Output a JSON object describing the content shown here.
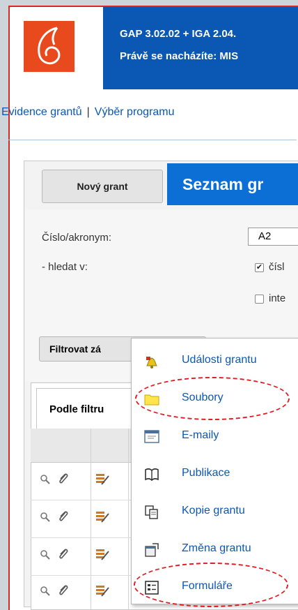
{
  "header": {
    "line1": "GAP 3.02.02 + IGA 2.04.",
    "line2": "Právě se nacházíte: MIS"
  },
  "nav": {
    "item1": "Evidence grantů",
    "separator": "|",
    "item2": "Výběr programu"
  },
  "toolbar": {
    "new_grant_label": "Nový grant",
    "list_title": "Seznam gr"
  },
  "filter": {
    "number_label": "Číslo/akronym:",
    "number_value": "A2",
    "search_in_label": "- hledat v:",
    "option1_label": "čísl",
    "option1_checked": true,
    "option2_label": "inte",
    "option2_checked": false,
    "filter_button_label": "Filtrovat zá"
  },
  "results": {
    "tab_label": "Podle filtru"
  },
  "context_menu": {
    "items": [
      {
        "label": "Události grantu",
        "icon": "bell-icon"
      },
      {
        "label": "Soubory",
        "icon": "folder-icon"
      },
      {
        "label": "E-maily",
        "icon": "email-icon"
      },
      {
        "label": "Publikace",
        "icon": "book-icon"
      },
      {
        "label": "Kopie grantu",
        "icon": "copy-icon"
      },
      {
        "label": "Změna grantu",
        "icon": "change-icon"
      },
      {
        "label": "Formuláře",
        "icon": "form-icon"
      }
    ]
  },
  "colors": {
    "brand_blue": "#0b57b4",
    "logo_orange": "#e8491d",
    "annotation_red": "#e31b23"
  }
}
